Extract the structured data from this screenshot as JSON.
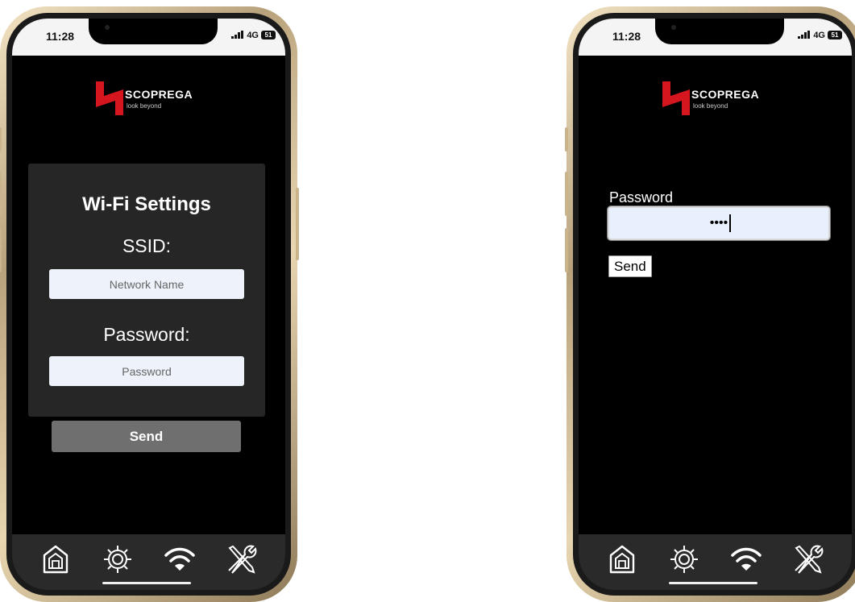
{
  "left_phone": {
    "status": {
      "time": "11:28",
      "network": "4G",
      "battery": "51"
    },
    "logo": {
      "brand": "SCOPREGA",
      "tagline": "look beyond"
    },
    "card": {
      "title": "Wi-Fi Settings",
      "ssid_label": "SSID:",
      "ssid_placeholder": "Network Name",
      "password_label": "Password:",
      "password_placeholder": "Password"
    },
    "send_label": "Send",
    "tabs": [
      "home-icon",
      "gear-icon",
      "wifi-icon",
      "tools-icon"
    ]
  },
  "right_phone": {
    "status": {
      "time": "11:28",
      "network": "4G",
      "battery": "51"
    },
    "logo": {
      "brand": "SCOPREGA",
      "tagline": "look beyond"
    },
    "password_label": "Password",
    "password_value": "••••",
    "send_label": "Send",
    "tabs": [
      "home-icon",
      "gear-icon",
      "wifi-icon",
      "tools-icon"
    ]
  },
  "colors": {
    "brand_red": "#d6161f",
    "screen_bg": "#000000",
    "card_bg": "#262626",
    "tabbar_bg": "#2a2a2a"
  }
}
